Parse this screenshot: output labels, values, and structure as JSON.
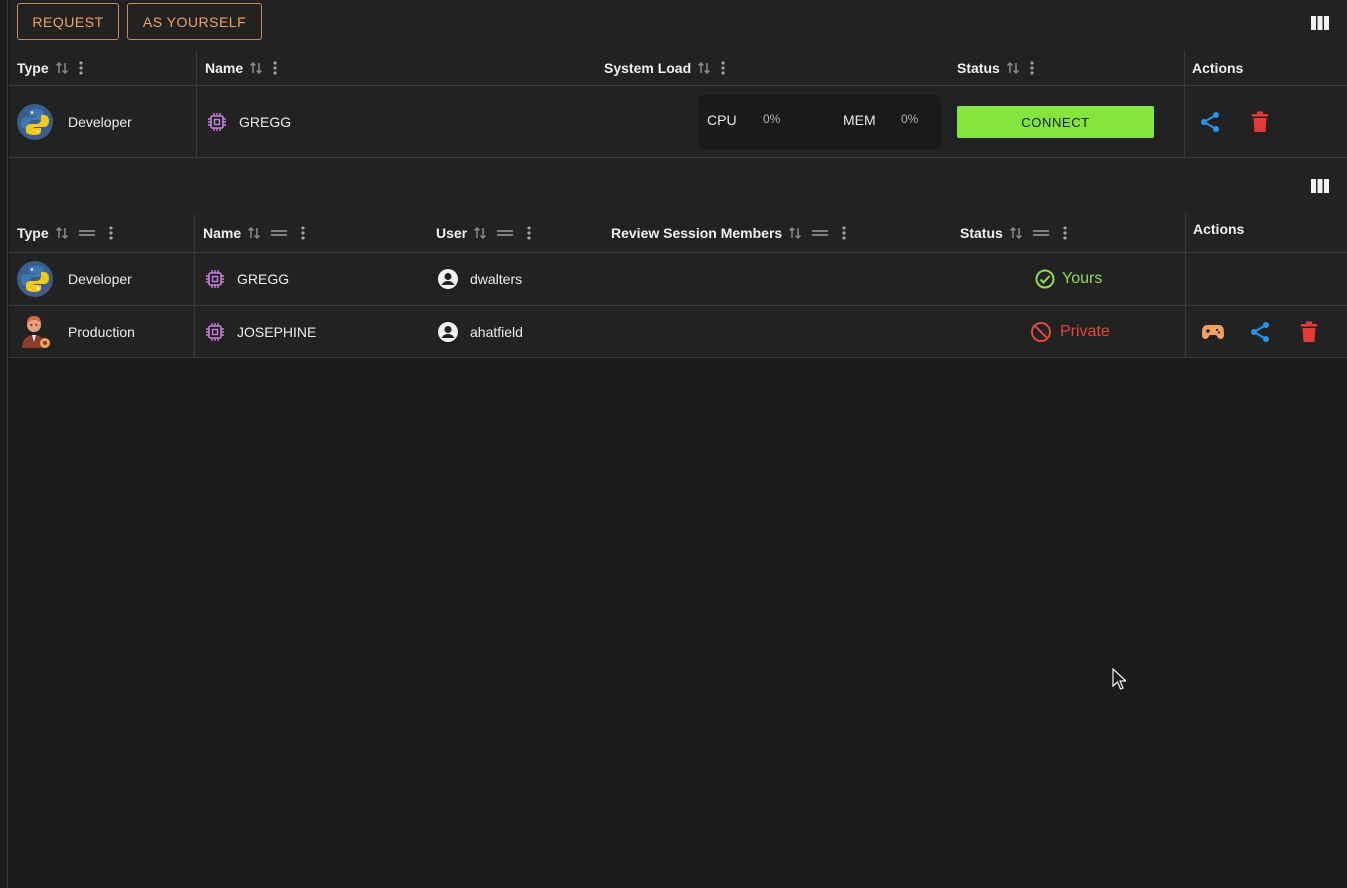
{
  "toolbar": {
    "request_label": "REQUEST",
    "as_yourself_label": "AS YOURSELF"
  },
  "top_table": {
    "headers": {
      "type": "Type",
      "name": "Name",
      "system_load": "System Load",
      "status": "Status",
      "actions": "Actions"
    },
    "row": {
      "type": "Developer",
      "name": "GREGG",
      "cpu_label": "CPU",
      "cpu_value": "0%",
      "mem_label": "MEM",
      "mem_value": "0%",
      "connect_label": "CONNECT"
    }
  },
  "bottom_table": {
    "headers": {
      "type": "Type",
      "name": "Name",
      "user": "User",
      "review": "Review Session Members",
      "status": "Status",
      "actions": "Actions"
    },
    "rows": [
      {
        "type": "Developer",
        "name": "GREGG",
        "user": "dwalters",
        "status": "Yours"
      },
      {
        "type": "Production",
        "name": "JOSEPHINE",
        "user": "ahatfield",
        "status": "Private"
      }
    ]
  },
  "colors": {
    "accent_orange": "#f2a25c",
    "connect_green": "#84e63c",
    "share_blue": "#2196f3",
    "delete_red": "#e53935",
    "chip_purple": "#c77ee0"
  }
}
